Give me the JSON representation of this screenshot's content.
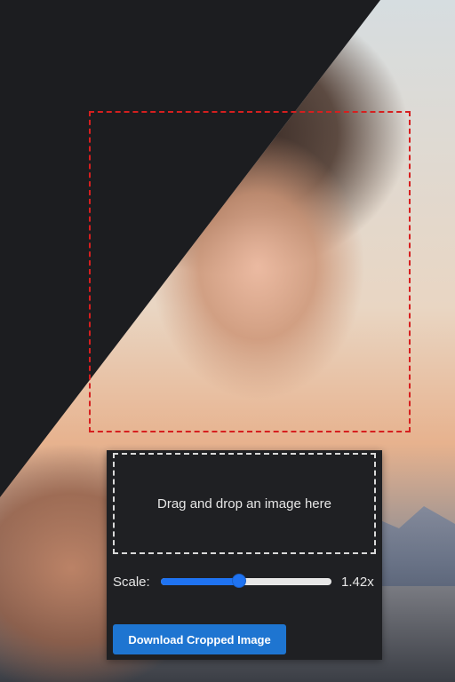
{
  "dropzone": {
    "text": "Drag and drop an image here"
  },
  "scale": {
    "label": "Scale:",
    "value_text": "1.42x",
    "slider_fraction": 0.46
  },
  "actions": {
    "download_label": "Download Cropped Image"
  },
  "colors": {
    "accent": "#1e75d1",
    "slider": "#1f73f2",
    "crop_outline": "#d61f1f",
    "panel_bg": "#1f2023",
    "page_bg": "#1c1d20"
  },
  "image": {
    "description_icon": "portrait-photo"
  }
}
